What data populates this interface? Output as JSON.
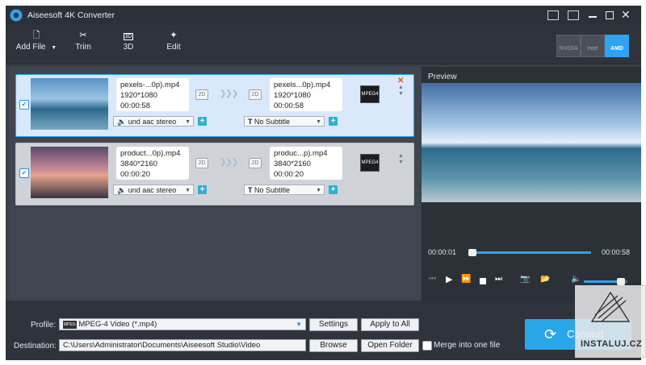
{
  "app": {
    "title": "Aiseesoft 4K Converter"
  },
  "toolbar": {
    "add_file": "Add File",
    "trim": "Trim",
    "threed": "3D",
    "edit": "Edit",
    "hw": [
      "NVIDIA",
      "Intel",
      "AMD"
    ]
  },
  "files": [
    {
      "src_name": "pexels-...0p).mp4",
      "src_res": "1920*1080",
      "src_dur": "00:00:58",
      "out_name": "pexels...0p).mp4",
      "out_res": "1920*1080",
      "out_dur": "00:00:58",
      "audio": "und aac stereo",
      "subtitle": "No Subtitle",
      "tag": "2D"
    },
    {
      "src_name": "product...0p).mp4",
      "src_res": "3840*2160",
      "src_dur": "00:00:20",
      "out_name": "produc...p).mp4",
      "out_res": "3840*2160",
      "out_dur": "00:00:20",
      "audio": "und aac stereo",
      "subtitle": "No Subtitle",
      "tag": "2D"
    }
  ],
  "preview": {
    "label": "Preview",
    "current_time": "00:00:01",
    "total_time": "00:00:58",
    "progress": 0.02,
    "volume": 0.8
  },
  "bottom": {
    "profile_label": "Profile:",
    "profile_value": "MPEG-4 Video (*.mp4)",
    "settings": "Settings",
    "apply_to_all": "Apply to All",
    "destination_label": "Destination:",
    "destination_value": "C:\\Users\\Administrator\\Documents\\Aiseesoft Studio\\Video",
    "browse": "Browse",
    "open_folder": "Open Folder",
    "merge": "Merge into one file",
    "convert": "Convert"
  },
  "watermark": {
    "text": "INSTALUJ.CZ"
  },
  "colors": {
    "accent": "#2fa2f2",
    "convert": "#2aa7e8",
    "window_bg": "#3a3f47"
  }
}
